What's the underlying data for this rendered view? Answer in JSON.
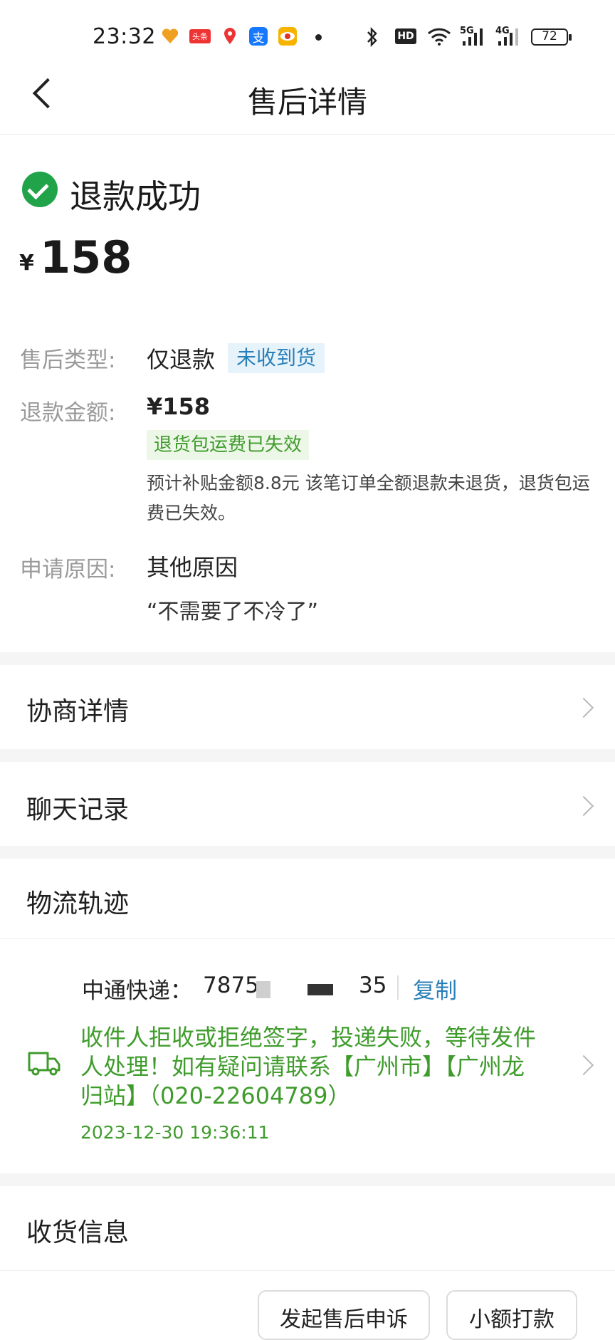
{
  "status_bar": {
    "time": "23:32",
    "app_icons": [
      "heart-app-icon",
      "toutiao-icon",
      "location-icon",
      "alipay-icon",
      "eye-app-icon"
    ],
    "network_hd": "HD",
    "net_5g": "5G",
    "net_4g": "4G",
    "battery": "72"
  },
  "header": {
    "title": "售后详情"
  },
  "refund": {
    "status": "退款成功",
    "currency": "¥",
    "amount": "158"
  },
  "details": {
    "type_label": "售后类型:",
    "type_value": "仅退款",
    "type_tag": "未收到货",
    "amount_label": "退款金额:",
    "amount_value": "¥158",
    "shipping_tag": "退货包运费已失效",
    "note": "预计补贴金额8.8元 该笔订单全额退款未退货，退货包运费已失效。",
    "reason_label": "申请原因:",
    "reason_value": "其他原因",
    "reason_quote": "“不需要了不冷了”"
  },
  "sections": {
    "negotiation": "协商详情",
    "chat": "聊天记录",
    "logistics": "物流轨迹",
    "receiving": "收货信息"
  },
  "logistics": {
    "courier": "中通快递：",
    "tracking_start": "7875",
    "tracking_end": "35",
    "copy": "复制",
    "message": "收件人拒收或拒绝签字，投递失败，等待发件人处理！如有疑问请联系【广州市】【广州龙归站】（020-22604789）",
    "time": "2023-12-30 19:36:11"
  },
  "actions": {
    "appeal": "发起售后申诉",
    "small_payment": "小额打款"
  },
  "colors": {
    "success_green": "#21a34a",
    "tag_blue": "#2a7fb8",
    "text_green": "#3f9c2c"
  }
}
